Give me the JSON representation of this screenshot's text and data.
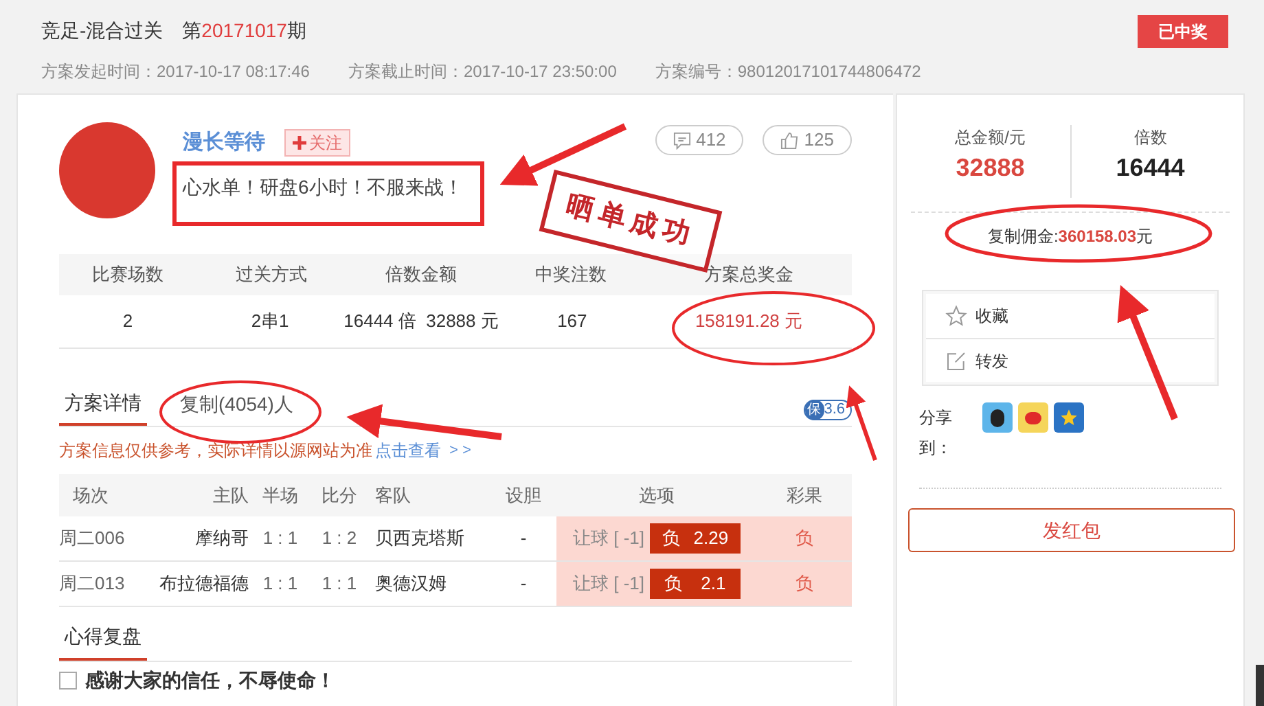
{
  "header": {
    "title": "竞足-混合过关",
    "period_prefix": "第",
    "period": "20171017",
    "period_suffix": "期",
    "status_badge": "已中奖",
    "meta": [
      "方案发起时间：2017-10-17 08:17:46",
      "方案截止时间：2017-10-17 23:50:00",
      "方案编号：98012017101744806472"
    ]
  },
  "author": {
    "name": "漫长等待",
    "follow": "关注",
    "motto": "心水单！研盘6小时！不服来战！",
    "comments": "412",
    "likes": "125"
  },
  "stamp": "晒单成功",
  "summary": {
    "columns": [
      "比赛场数",
      "过关方式",
      "倍数金额",
      "中奖注数",
      "方案总奖金"
    ],
    "row": [
      "2",
      "2串1",
      "16444 倍  32888 元",
      "167",
      "158191.28 元"
    ]
  },
  "tabs": [
    {
      "label": "方案详情",
      "selected": true
    },
    {
      "label": "复制(4054)人",
      "selected": false
    }
  ],
  "insurance": {
    "icon_text": "保",
    "value": "3.6"
  },
  "notice": {
    "text": "方案信息仅供参考，实际详情以源网站为准",
    "link": "点击查看",
    "more": "> >"
  },
  "matches": {
    "columns": [
      "场次",
      "主队",
      "半场",
      "比分",
      "客队",
      "设胆",
      "选项",
      "彩果"
    ],
    "rows": [
      {
        "match": "周二006",
        "home": "摩纳哥",
        "half": "1 : 1",
        "score": "1 : 2",
        "away": "贝西克塔斯",
        "banker": "-",
        "handicap": "让球 [ -1]",
        "pick": "负",
        "odds": "2.29",
        "result": "负"
      },
      {
        "match": "周二013",
        "home": "布拉德福德",
        "half": "1 : 1",
        "score": "1 : 1",
        "away": "奥德汉姆",
        "banker": "-",
        "handicap": "让球 [ -1]",
        "pick": "负",
        "odds": "2.1",
        "result": "负"
      }
    ]
  },
  "review": {
    "title": "心得复盘",
    "text": "感谢大家的信任，不辱使命！",
    "checked": false
  },
  "sidebar": {
    "total_label": "总金额/元",
    "total": "32888",
    "multiple_label": "倍数",
    "multiple": "16444",
    "commission_label": "复制佣金:",
    "commission": "360158.03",
    "commission_unit": "元",
    "actions": [
      {
        "kind": "star",
        "label": "收藏"
      },
      {
        "kind": "edit",
        "label": "转发"
      }
    ],
    "share_label": "分享到：",
    "red_packet": "发红包"
  }
}
